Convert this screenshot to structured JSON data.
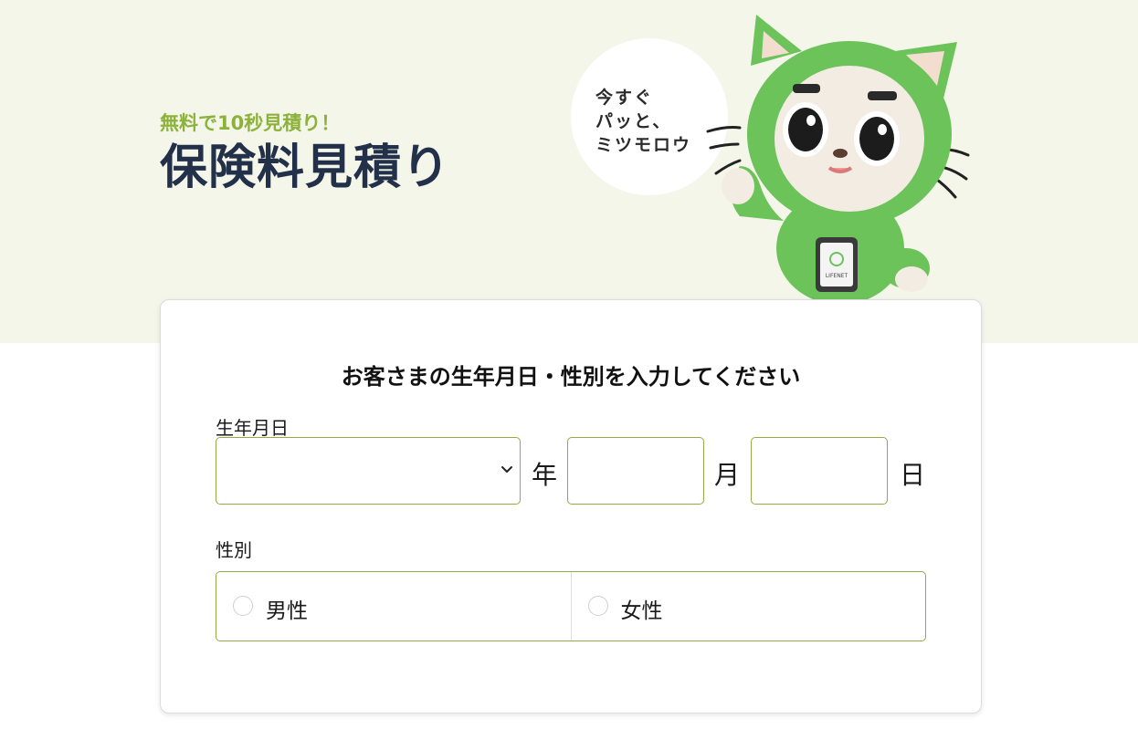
{
  "hero": {
    "tagline": "無料で10秒見積り！",
    "title": "保険料見積り",
    "bubble_lines": [
      "今すぐ",
      "パッと、",
      "ミツモロウ"
    ],
    "device_label": "LIFENET",
    "background_color": "#f5f6ea",
    "accent_color": "#8db23c",
    "title_color": "#22304a"
  },
  "form": {
    "heading": "お客さまの生年月日・性別を入力してください",
    "birthdate": {
      "label": "生年月日",
      "year_value": "",
      "year_unit": "年",
      "month_value": "",
      "month_unit": "月",
      "day_value": "",
      "day_unit": "日"
    },
    "gender": {
      "label": "性別",
      "options": [
        {
          "label": "男性",
          "selected": false
        },
        {
          "label": "女性",
          "selected": false
        }
      ]
    },
    "border_color": "#8fae3f"
  },
  "icons": {
    "select_arrow": "chevron-down-icon",
    "mascot": "green-cat-mascot"
  }
}
